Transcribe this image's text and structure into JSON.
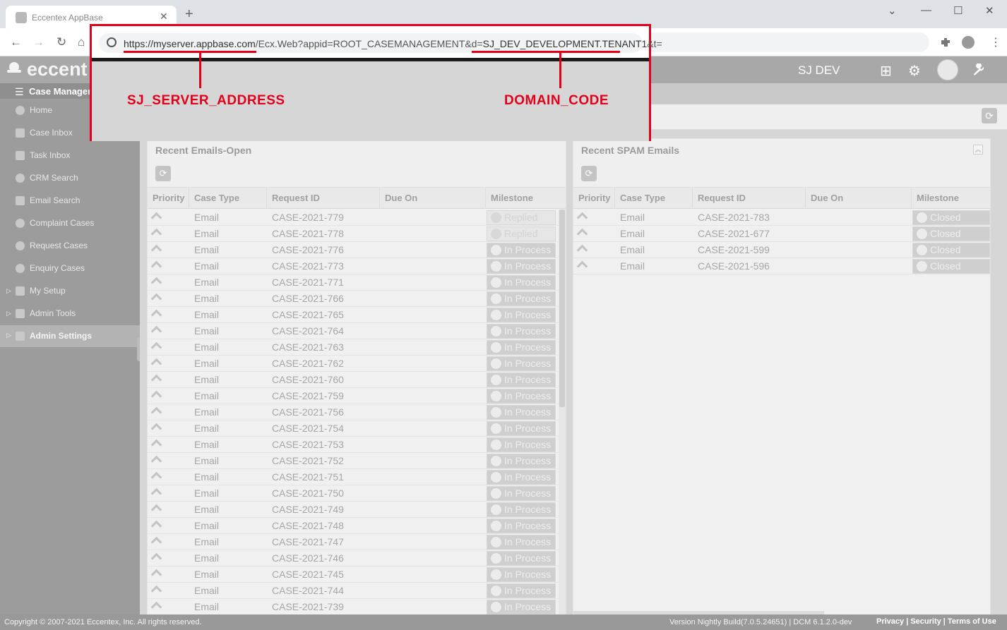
{
  "browser": {
    "tab_title": "Eccentex AppBase",
    "tab_close": "✕",
    "new_tab": "+",
    "url_prefix": "https://myserver.appbase.com",
    "url_middle": "/Ecx.Web?appid=ROOT_CASEMANAGEMENT&d=",
    "url_domain": "SJ_DEV_DEVELOPMENT.TENANT1",
    "url_suffix": "&t=",
    "back": "←",
    "forward": "→",
    "reload": "↻",
    "home": "⌂",
    "minimize": "—",
    "maximize": "☐",
    "close": "✕",
    "chevron": "⌄"
  },
  "header": {
    "logo_text": "eccent",
    "tenant": "SJ DEV",
    "apps_icon": "⊞",
    "gear_icon": "⚙",
    "wrench_icon": "🔧"
  },
  "sidebar": {
    "section_label": "Case Managem",
    "items": [
      {
        "label": "Home",
        "icon": "home-icon"
      },
      {
        "label": "Case Inbox",
        "icon": "case-inbox-icon"
      },
      {
        "label": "Task Inbox",
        "icon": "task-inbox-icon"
      },
      {
        "label": "CRM Search",
        "icon": "crm-search-icon"
      },
      {
        "label": "Email Search",
        "icon": "email-icon"
      },
      {
        "label": "Complaint Cases",
        "icon": "complaint-icon"
      },
      {
        "label": "Request Cases",
        "icon": "request-icon"
      },
      {
        "label": "Enquiry Cases",
        "icon": "enquiry-icon"
      },
      {
        "label": "My Setup",
        "icon": "wrench-icon"
      },
      {
        "label": "Admin Tools",
        "icon": "wrench-icon"
      },
      {
        "label": "Admin Settings",
        "icon": "folder-icon"
      }
    ]
  },
  "annotation": {
    "server_label": "SJ_SERVER_ADDRESS",
    "domain_label": "DOMAIN_CODE"
  },
  "panels": {
    "open": {
      "title": "Recent Emails-Open",
      "columns": [
        "Priority",
        "Case Type",
        "Request ID",
        "Due On",
        "Milestone"
      ],
      "rows": [
        {
          "type": "Email",
          "id": "CASE-2021-779",
          "milestone": "Replied"
        },
        {
          "type": "Email",
          "id": "CASE-2021-778",
          "milestone": "Replied"
        },
        {
          "type": "Email",
          "id": "CASE-2021-776",
          "milestone": "In Process"
        },
        {
          "type": "Email",
          "id": "CASE-2021-773",
          "milestone": "In Process"
        },
        {
          "type": "Email",
          "id": "CASE-2021-771",
          "milestone": "In Process"
        },
        {
          "type": "Email",
          "id": "CASE-2021-766",
          "milestone": "In Process"
        },
        {
          "type": "Email",
          "id": "CASE-2021-765",
          "milestone": "In Process"
        },
        {
          "type": "Email",
          "id": "CASE-2021-764",
          "milestone": "In Process"
        },
        {
          "type": "Email",
          "id": "CASE-2021-763",
          "milestone": "In Process"
        },
        {
          "type": "Email",
          "id": "CASE-2021-762",
          "milestone": "In Process"
        },
        {
          "type": "Email",
          "id": "CASE-2021-760",
          "milestone": "In Process"
        },
        {
          "type": "Email",
          "id": "CASE-2021-759",
          "milestone": "In Process"
        },
        {
          "type": "Email",
          "id": "CASE-2021-756",
          "milestone": "In Process"
        },
        {
          "type": "Email",
          "id": "CASE-2021-754",
          "milestone": "In Process"
        },
        {
          "type": "Email",
          "id": "CASE-2021-753",
          "milestone": "In Process"
        },
        {
          "type": "Email",
          "id": "CASE-2021-752",
          "milestone": "In Process"
        },
        {
          "type": "Email",
          "id": "CASE-2021-751",
          "milestone": "In Process"
        },
        {
          "type": "Email",
          "id": "CASE-2021-750",
          "milestone": "In Process"
        },
        {
          "type": "Email",
          "id": "CASE-2021-749",
          "milestone": "In Process"
        },
        {
          "type": "Email",
          "id": "CASE-2021-748",
          "milestone": "In Process"
        },
        {
          "type": "Email",
          "id": "CASE-2021-747",
          "milestone": "In Process"
        },
        {
          "type": "Email",
          "id": "CASE-2021-746",
          "milestone": "In Process"
        },
        {
          "type": "Email",
          "id": "CASE-2021-745",
          "milestone": "In Process"
        },
        {
          "type": "Email",
          "id": "CASE-2021-744",
          "milestone": "In Process"
        },
        {
          "type": "Email",
          "id": "CASE-2021-739",
          "milestone": "In Process"
        }
      ]
    },
    "spam": {
      "title": "Recent SPAM Emails",
      "columns": [
        "Priority",
        "Case Type",
        "Request ID",
        "Due On",
        "Milestone"
      ],
      "rows": [
        {
          "type": "Email",
          "id": "CASE-2021-783",
          "milestone": "Closed"
        },
        {
          "type": "Email",
          "id": "CASE-2021-677",
          "milestone": "Closed"
        },
        {
          "type": "Email",
          "id": "CASE-2021-599",
          "milestone": "Closed"
        },
        {
          "type": "Email",
          "id": "CASE-2021-596",
          "milestone": "Closed"
        }
      ]
    }
  },
  "footer": {
    "copyright": "Copyright © 2007-2021 Eccentex, Inc. All rights reserved.",
    "version": "Version   Nightly Build(7.0.5.24651) | DCM 6.1.2.0-dev",
    "links": "Privacy  |  Security  |  Terms of Use"
  }
}
